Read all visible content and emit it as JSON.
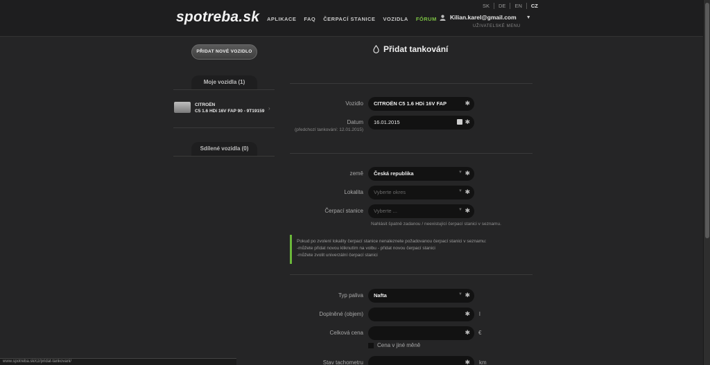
{
  "header": {
    "logo": "spotreba.sk",
    "nav": [
      "APLIKACE",
      "FAQ",
      "ČERPACÍ STANICE",
      "VOZIDLA",
      "FÓRUM"
    ],
    "languages": [
      "SK",
      "DE",
      "EN",
      "CZ"
    ],
    "user_email": "Kilian.karel@gmail.com",
    "user_menu": "UŽIVATELSKÉ MENU"
  },
  "sidebar": {
    "add_vehicle": "PŘIDAT NOVÉ VOZIDLO",
    "my_vehicles": "Moje vozidla (1)",
    "vehicle_name": "CITROËN",
    "vehicle_model": "C5 1.6 HDi 16V FAP 90 - 9T19159",
    "shared_vehicles": "Sdílené vozidla (0)"
  },
  "form": {
    "title": "Přidat tankování",
    "vehicle_label": "Vozidlo",
    "vehicle_value": "CITROËN C5 1.6 HDi 16V FAP",
    "date_label": "Datum",
    "date_sub": "(předchozí tankování: 12.01.2015)",
    "date_value": "16.01.2015",
    "country_label": "země",
    "country_value": "Česká republika",
    "locality_label": "Lokalita",
    "locality_placeholder": "Vyberte okres",
    "station_label": "Čerpací stanice",
    "station_placeholder": "Vyberte ...",
    "station_hint": "Nahlásit špatně zadanou / neexistující čerpací stanici v seznamu.",
    "info_lines": [
      "Pokud po zvolení lokality čerpací stanice nenaleznete požadovanou čerpací stanici v seznamu:",
      "-můžete přidat novou kliknutím na volbu - přidat novou čerpací stanici",
      "-můžete zvolit univerzální čerpací stanici"
    ],
    "fuel_label": "Typ paliva",
    "fuel_value": "Nafta",
    "volume_label": "Doplněné (objem)",
    "volume_unit": "l",
    "price_label": "Celková cena",
    "price_unit": "€",
    "currency_checkbox": "Cena v jiné měně",
    "odometer_label": "Stav tachometru",
    "odometer_unit": "km",
    "required_mark": "✱"
  },
  "status_url": "www.spotreba.sk/cz/pridat-tankovani/",
  "colors": {
    "accent": "#7bc043",
    "background": "#252526"
  }
}
